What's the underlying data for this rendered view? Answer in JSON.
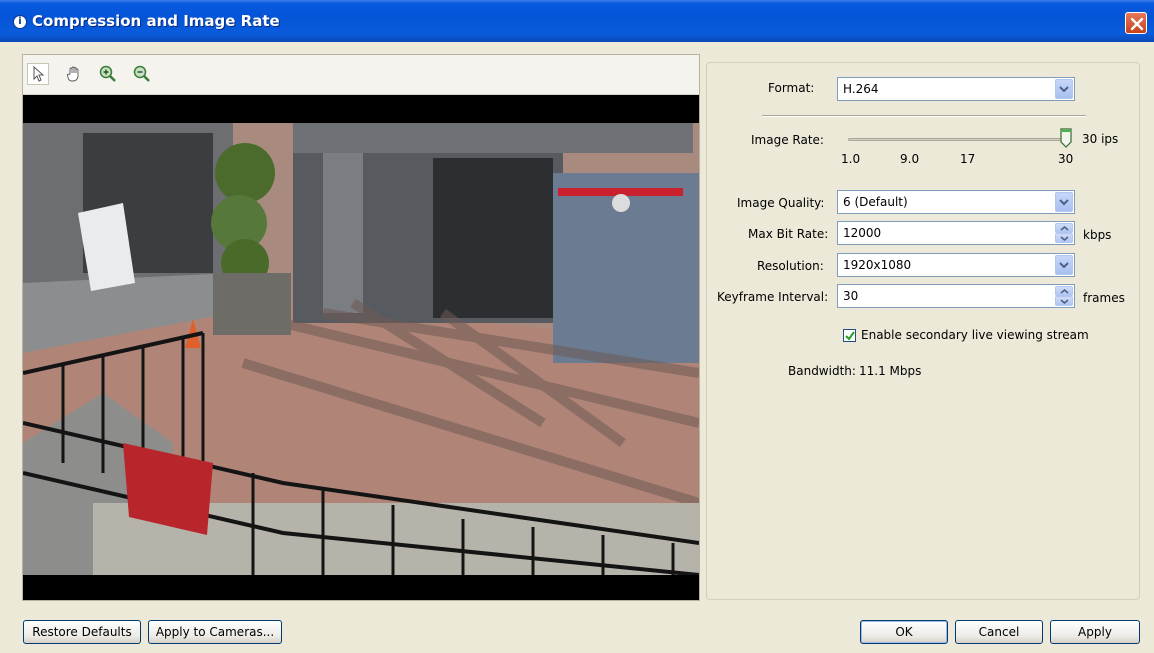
{
  "window": {
    "title": "Compression and Image Rate",
    "title_icon": "camera-settings-icon",
    "close_icon": "close-icon"
  },
  "preview": {
    "tools": [
      "pointer-icon",
      "hand-pan-icon",
      "zoom-in-icon",
      "zoom-out-icon"
    ],
    "image_description_colors": {
      "letterbox": "#000000"
    }
  },
  "settings": {
    "format": {
      "label": "Format:",
      "value": "H.264"
    },
    "image_rate": {
      "label": "Image Rate:",
      "value_text": "30 ips",
      "ticks": [
        "1.0",
        "9.0",
        "17",
        "30"
      ],
      "min": 1.0,
      "max": 30,
      "value": 30
    },
    "image_quality": {
      "label": "Image Quality:",
      "value": "6 (Default)"
    },
    "max_bit_rate": {
      "label": "Max Bit Rate:",
      "value": "12000",
      "unit": "kbps"
    },
    "resolution": {
      "label": "Resolution:",
      "value": "1920x1080"
    },
    "keyframe_interval": {
      "label": "Keyframe Interval:",
      "value": "30",
      "unit": "frames"
    },
    "secondary_stream": {
      "label": "Enable secondary live viewing stream",
      "checked": true
    },
    "bandwidth": {
      "label": "Bandwidth:",
      "value": "11.1 Mbps"
    }
  },
  "buttons": {
    "restore_defaults": "Restore Defaults",
    "apply_to_cameras": "Apply to Cameras...",
    "ok": "OK",
    "cancel": "Cancel",
    "apply": "Apply"
  },
  "colors": {
    "titlebar": "#0354d6",
    "dialog_bg": "#ece9d8",
    "close_button": "#d2502b"
  }
}
